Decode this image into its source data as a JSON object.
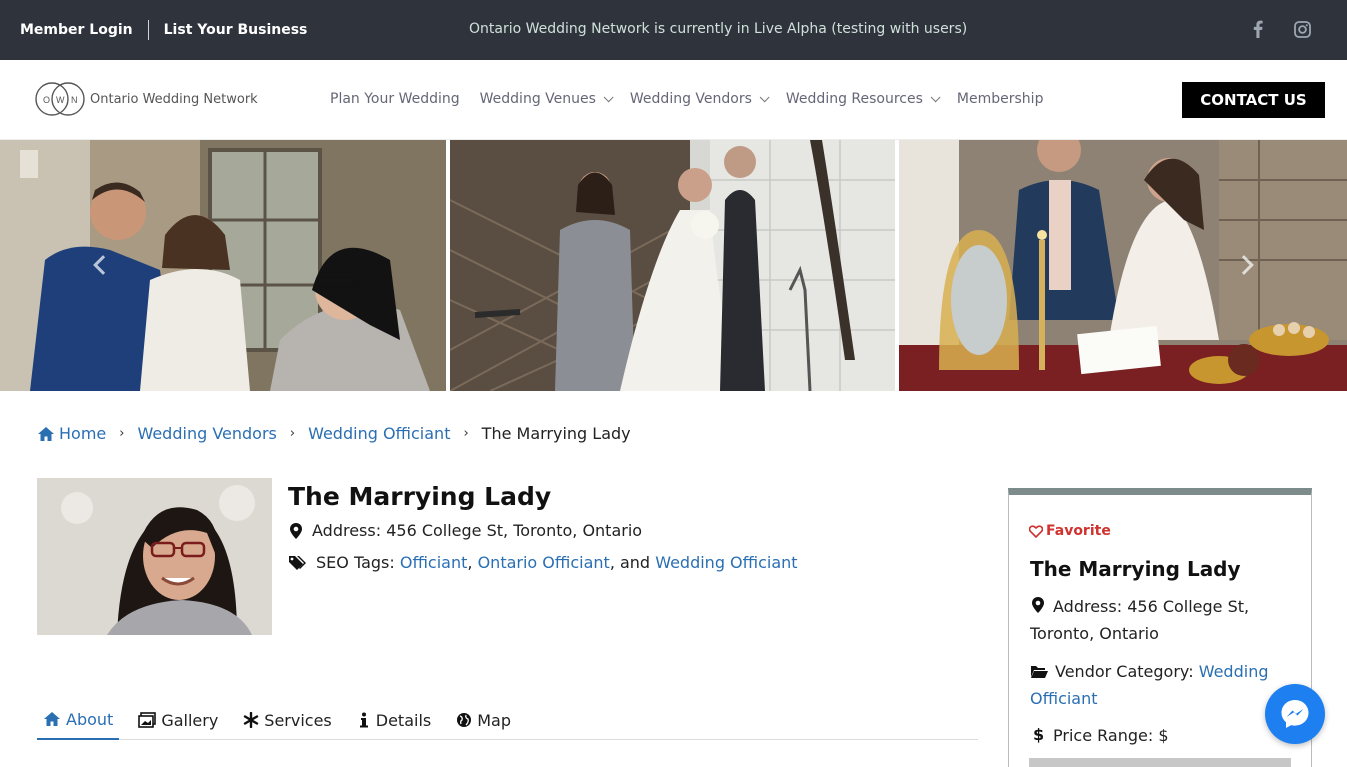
{
  "topbar": {
    "member_login": "Member Login",
    "list_business": "List Your Business",
    "announcement": "Ontario Wedding Network is currently in Live Alpha (testing with users)"
  },
  "header": {
    "logo_letters": [
      "O",
      "W",
      "N"
    ],
    "logo_text": "Ontario Wedding Network",
    "nav": [
      {
        "label": "Plan Your Wedding"
      },
      {
        "label": "Wedding Venues"
      },
      {
        "label": "Wedding Vendors"
      },
      {
        "label": "Wedding Resources"
      },
      {
        "label": "Membership"
      }
    ],
    "contact_label": "CONTACT US"
  },
  "breadcrumb": {
    "home": "Home",
    "vendors": "Wedding Vendors",
    "category": "Wedding Officiant",
    "current": "The Marrying Lady"
  },
  "profile": {
    "name": "The Marrying Lady",
    "address_label": "Address:",
    "address_value": "456 College St, Toronto, Ontario",
    "seo_label": "SEO Tags:",
    "tags": [
      "Officiant",
      "Ontario Officiant",
      "Wedding Officiant"
    ],
    "tag_sep1": ",",
    "tag_sep2": ", and"
  },
  "tabs": [
    {
      "label": "About"
    },
    {
      "label": "Gallery"
    },
    {
      "label": "Services"
    },
    {
      "label": "Details"
    },
    {
      "label": "Map"
    }
  ],
  "card": {
    "favorite": "Favorite",
    "name": "The Marrying Lady",
    "address_label": "Address:",
    "address_value": "456 College St, Toronto, Ontario",
    "category_label": "Vendor Category:",
    "category_value": "Wedding Officiant",
    "price_label": "Price Range:",
    "price_value": "$"
  },
  "colors": {
    "topbar": "#2f333c",
    "link": "#2b6fb3",
    "favorite": "#d0322e",
    "messenger": "#1d7ff0"
  }
}
